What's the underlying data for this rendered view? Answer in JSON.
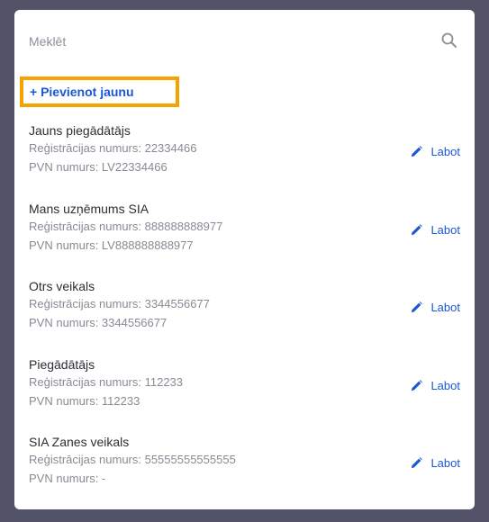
{
  "search": {
    "placeholder": "Meklēt",
    "value": ""
  },
  "add_new_label": "+ Pievienot jaunu",
  "suppliers": [
    {
      "name": "Jauns piegādātājs",
      "reg": "Reģistrācijas numurs: 22334466",
      "vat": "PVN numurs: LV22334466",
      "edit_label": "Labot"
    },
    {
      "name": "Mans uzņēmums SIA",
      "reg": "Reģistrācijas numurs: 888888888977",
      "vat": "PVN numurs: LV888888888977",
      "edit_label": "Labot"
    },
    {
      "name": "Otrs veikals",
      "reg": "Reģistrācijas numurs: 3344556677",
      "vat": "PVN numurs: 3344556677",
      "edit_label": "Labot"
    },
    {
      "name": "Piegādātājs",
      "reg": "Reģistrācijas numurs: 112233",
      "vat": "PVN numurs: 112233",
      "edit_label": "Labot"
    },
    {
      "name": "SIA Zanes veikals",
      "reg": "Reģistrācijas numurs: 55555555555555",
      "vat": "PVN numurs: -",
      "edit_label": "Labot"
    }
  ],
  "icons": {
    "search": "search-icon",
    "edit": "pencil-icon"
  },
  "colors": {
    "backdrop": "#525368",
    "panel": "#ffffff",
    "accent": "#1c57d6",
    "highlight": "#f5a300",
    "muted_text": "#8a8a95",
    "primary_text": "#2d2d35"
  }
}
